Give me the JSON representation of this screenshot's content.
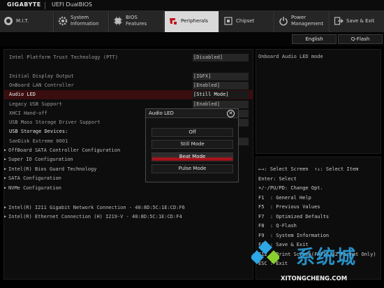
{
  "header": {
    "brand": "GIGABYTE",
    "product": "UEFI DualBIOS"
  },
  "tabs": [
    {
      "label": "M.I.T.",
      "icon": "circle-gauge-icon",
      "active": false
    },
    {
      "label": "System\nInformation",
      "icon": "gear-icon",
      "active": false
    },
    {
      "label": "BIOS\nFeatures",
      "icon": "chip-icon",
      "active": false
    },
    {
      "label": "Peripherals",
      "icon": "peripherals-icon",
      "active": true
    },
    {
      "label": "Chipset",
      "icon": "chipset-icon",
      "active": false
    },
    {
      "label": "Power\nManagement",
      "icon": "power-icon",
      "active": false
    },
    {
      "label": "Save & Exit",
      "icon": "exit-icon",
      "active": false
    }
  ],
  "subbar": {
    "english": "English",
    "qflash": "Q-Flash"
  },
  "settings": [
    {
      "label": "Intel Platform Trust Technology (PTT)",
      "value": "[Disabled]",
      "style": "normal"
    },
    {
      "label": "Initial Display Output",
      "value": "[IGFX]",
      "style": "normal"
    },
    {
      "label": "OnBoard LAN Controller",
      "value": "[Enabled]",
      "style": "normal"
    },
    {
      "label": "Audio LED",
      "value": "[Still Mode]",
      "style": "highlight"
    },
    {
      "label": "Legacy USB Support",
      "value": "[Enabled]",
      "style": "normal"
    },
    {
      "label": "XHCI Hand-off",
      "value": "",
      "style": "normal"
    },
    {
      "label": "USB Mass Storage Driver Support",
      "value": "",
      "style": "normal"
    },
    {
      "label": "USB Storage Devices:",
      "value": "",
      "style": "white"
    },
    {
      "label": "SanDisk Extreme 0001",
      "value": "",
      "style": "normal"
    },
    {
      "label": "OffBoard SATA Controller Configuration",
      "value": "",
      "style": "arrow"
    },
    {
      "label": "Super IO Configuration",
      "value": "",
      "style": "arrow"
    },
    {
      "label": "Intel(R) Bios Guard Technology",
      "value": "",
      "style": "arrow"
    },
    {
      "label": "SATA Configuration",
      "value": "",
      "style": "arrow"
    },
    {
      "label": "NVMe Configuration",
      "value": "",
      "style": "arrow"
    },
    {
      "label": "Intel(R) I211 Gigabit  Network Connection - 40:8D:5C:1E:CD:F6",
      "value": "",
      "style": "arrow"
    },
    {
      "label": "Intel(R) Ethernet Connection (H) I219-V - 40:8D:5C:1E:CD:F4",
      "value": "",
      "style": "arrow"
    }
  ],
  "help": {
    "text": "Onboard Audio LED mode"
  },
  "keys": [
    "←→: Select Screen  ↑↓: Select Item",
    "Enter: Select",
    "+/-/PU/PD: Change Opt.",
    "F1  : General Help",
    "F5  : Previous Values",
    "F7  : Optimized Defaults",
    "F8  : Q-Flash",
    "F9  : System Information",
    "F10 : Save & Exit",
    "F12 : Print Screen(FAT16/32 Format Only)",
    "ESC : Exit"
  ],
  "popup": {
    "title": "Audio LED",
    "options": [
      "Off",
      "Still Mode",
      "Beat Mode",
      "Pulse Mode"
    ],
    "selected_index": 2
  },
  "watermark": {
    "text_cn": "系统城",
    "url": "XITONGCHENG.COM"
  },
  "colors": {
    "accent": "#c1121c",
    "highlight_row": "#3a0d0f",
    "active_tab": "#d9d9d9",
    "watermark_blue": "#2da7e6"
  }
}
